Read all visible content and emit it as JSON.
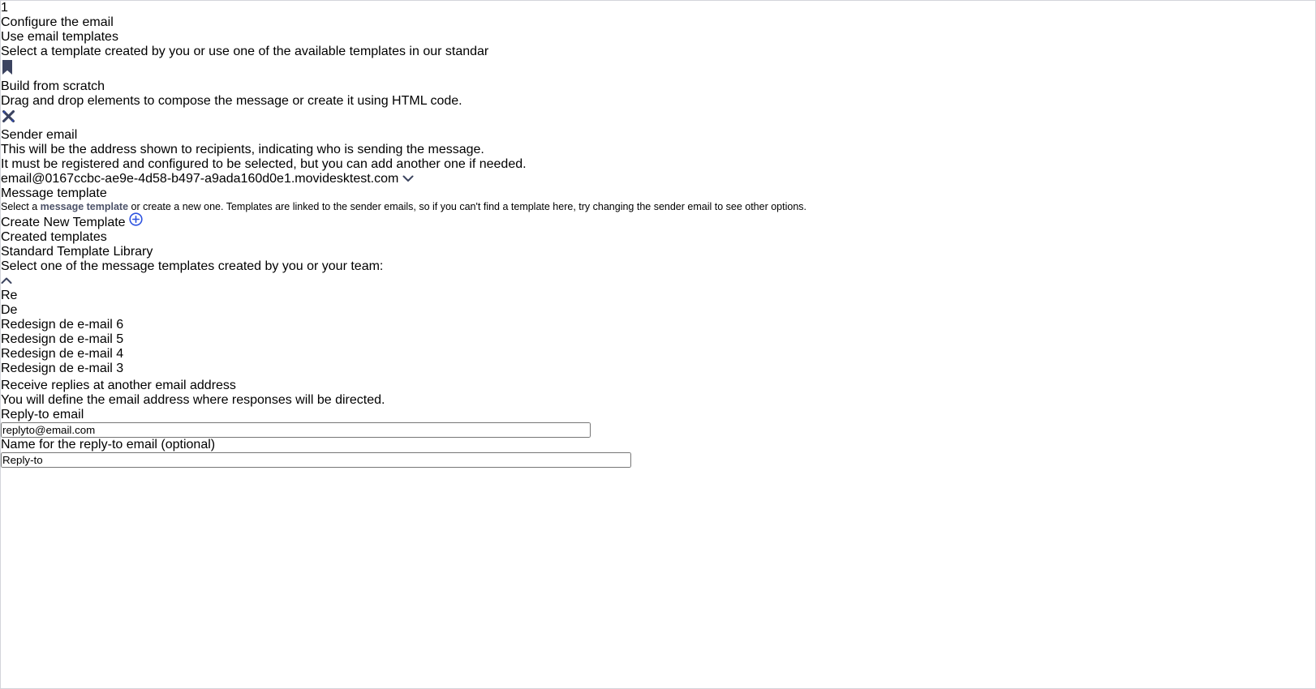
{
  "header": {
    "step": "1",
    "title": "Configure the email"
  },
  "cards": [
    {
      "title": "Use email templates",
      "description": "Select a template created by you or use one of the available templates in our standar",
      "selected": true,
      "icon": "bookmark-icon"
    },
    {
      "title": "Build from scratch",
      "description": "Drag and drop elements to compose the message or create it using HTML code.",
      "selected": false,
      "icon": "tools-icon"
    }
  ],
  "sender": {
    "label": "Sender email",
    "desc1": "This will be the address shown to recipients, indicating who is sending the message.",
    "desc2": "It must be registered and configured to be selected, but you can add another one if needed.",
    "value": "email@0167ccbc-ae9e-4d58-b497-a9ada160d0e1.movidesktest.com"
  },
  "template": {
    "label": "Message template",
    "desc_pre": "Select a ",
    "desc_bold": "message template",
    "desc_post": " or create a new one. Templates are linked to the sender emails, so if you can't find a template here, try changing the sender email to see other options.",
    "create_link": "Create New Template",
    "tabs": [
      {
        "label": "Created templates",
        "active": true
      },
      {
        "label": "Standard Template Library",
        "active": false
      }
    ],
    "select_label": "Select one of the message templates created by you or your team:",
    "combobox_value": "",
    "options": [
      "Redesign de e-mail 6",
      "Redesign de e-mail 5",
      "Redesign de e-mail 4",
      "Redesign de e-mail 3"
    ],
    "highlighted_option": "Redesign de e-mail 5"
  },
  "fragments": {
    "title_fragment": "Re",
    "description_fragment": "De"
  },
  "reply": {
    "option_label": "Receive replies at another email address",
    "option_description": "You will define the email address where responses will be directed.",
    "email_label": "Reply-to email",
    "email_value": "replyto@email.com",
    "name_label": "Name for the reply-to email (optional)",
    "name_value": "Reply-to"
  },
  "colors": {
    "accent_blue": "#2b4bd7",
    "link_blue": "#2d53e0",
    "annotation_red": "#e43934",
    "panel_gray": "#f1f2f4",
    "gradient_left": "#5d31d4",
    "gradient_center": "#e70c84",
    "gradient_right": "#a87cf2",
    "step_number_gold": "#d2a254"
  }
}
